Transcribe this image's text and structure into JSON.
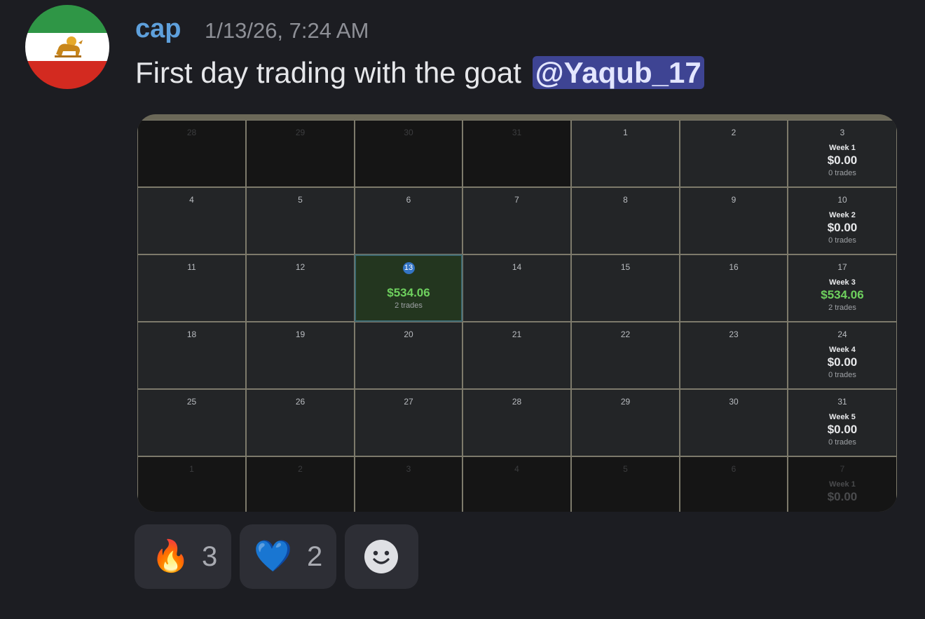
{
  "message": {
    "author": "cap",
    "timestamp": "1/13/26, 7:24 AM",
    "text": "First day trading with the goat",
    "mention": "@Yaqub_17"
  },
  "calendar": {
    "weeks": [
      {
        "days": [
          {
            "n": "28",
            "out": true
          },
          {
            "n": "29",
            "out": true
          },
          {
            "n": "30",
            "out": true
          },
          {
            "n": "31",
            "out": true
          },
          {
            "n": "1"
          },
          {
            "n": "2"
          },
          {
            "n": "3"
          }
        ],
        "summary": {
          "label": "Week 1",
          "amount": "$0.00",
          "trades": "0 trades"
        }
      },
      {
        "days": [
          {
            "n": "4"
          },
          {
            "n": "5"
          },
          {
            "n": "6"
          },
          {
            "n": "7"
          },
          {
            "n": "8"
          },
          {
            "n": "9"
          },
          {
            "n": "10"
          }
        ],
        "summary": {
          "label": "Week 2",
          "amount": "$0.00",
          "trades": "0 trades"
        }
      },
      {
        "days": [
          {
            "n": "11"
          },
          {
            "n": "12"
          },
          {
            "n": "13",
            "today": true,
            "amount": "$534.06",
            "trades": "2 trades"
          },
          {
            "n": "14"
          },
          {
            "n": "15"
          },
          {
            "n": "16"
          },
          {
            "n": "17"
          }
        ],
        "summary": {
          "label": "Week 3",
          "amount": "$534.06",
          "trades": "2 trades",
          "positive": true
        }
      },
      {
        "days": [
          {
            "n": "18"
          },
          {
            "n": "19"
          },
          {
            "n": "20"
          },
          {
            "n": "21"
          },
          {
            "n": "22"
          },
          {
            "n": "23"
          },
          {
            "n": "24"
          }
        ],
        "summary": {
          "label": "Week 4",
          "amount": "$0.00",
          "trades": "0 trades"
        }
      },
      {
        "days": [
          {
            "n": "25"
          },
          {
            "n": "26"
          },
          {
            "n": "27"
          },
          {
            "n": "28"
          },
          {
            "n": "29"
          },
          {
            "n": "30"
          },
          {
            "n": "31"
          }
        ],
        "summary": {
          "label": "Week 5",
          "amount": "$0.00",
          "trades": "0 trades"
        }
      },
      {
        "days": [
          {
            "n": "1",
            "out": true
          },
          {
            "n": "2",
            "out": true
          },
          {
            "n": "3",
            "out": true
          },
          {
            "n": "4",
            "out": true
          },
          {
            "n": "5",
            "out": true
          },
          {
            "n": "6",
            "out": true
          },
          {
            "n": "7",
            "out": true
          }
        ],
        "summary": {
          "label": "Week 1",
          "amount": "$0.00",
          "trades": ""
        }
      }
    ]
  },
  "reactions": [
    {
      "icon": "fire-emoji",
      "emoji": "🔥",
      "count": "3"
    },
    {
      "icon": "blue-heart-emoji",
      "emoji": "💙",
      "count": "2"
    },
    {
      "icon": "add-reaction-smiley-icon"
    }
  ],
  "colors": {
    "background": "#1c1d22",
    "username": "#5ea0dc",
    "mention_bg": "#3e4493",
    "profit": "#6ed05e"
  }
}
